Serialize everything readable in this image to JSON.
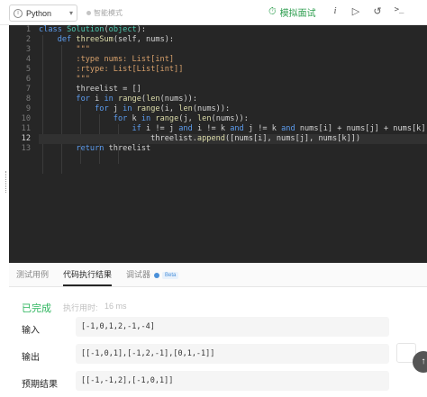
{
  "toolbar": {
    "language": "Python",
    "smart_mode": "智能模式",
    "mock_interview": "模拟面试",
    "icons": [
      "info-icon",
      "run-icon",
      "reset-icon",
      "terminal-icon"
    ]
  },
  "editor": {
    "line_numbers": [
      "1",
      "2",
      "3",
      "4",
      "5",
      "6",
      "7",
      "8",
      "9",
      "10",
      "11",
      "12",
      "13"
    ],
    "active_line": 12
  },
  "tabs": [
    {
      "label": "测试用例",
      "active": false
    },
    {
      "label": "代码执行结果",
      "active": true
    },
    {
      "label": "调试器",
      "active": false,
      "badge": "Beta"
    }
  ],
  "result": {
    "status": "已完成",
    "runtime_label": "执行用时:",
    "runtime_value": "16 ms",
    "input_label": "输入",
    "input_value": "[-1,0,1,2,-1,-4]",
    "output_label": "输出",
    "output_value": "[[-1,0,1],[-1,2,-1],[0,1,-1]]",
    "expected_label": "预期结果",
    "expected_value": "[[-1,-1,2],[-1,0,1]]"
  },
  "colors": {
    "editor_bg": "#262626",
    "keyword": "#5d9df0",
    "string": "#d7a06b",
    "success": "#2db55d",
    "mock_interview": "#2e9e4f"
  }
}
